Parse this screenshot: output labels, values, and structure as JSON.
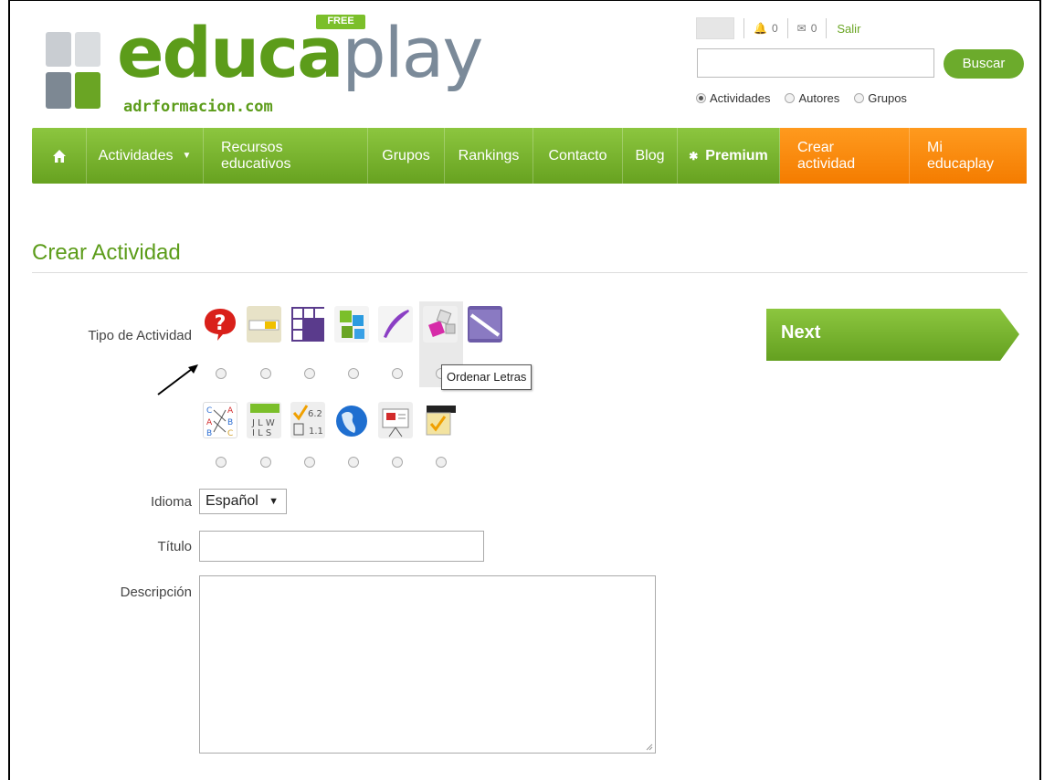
{
  "brand": {
    "logo_main_a": "educa",
    "logo_main_b": "play",
    "logo_sub_a": "adr",
    "logo_sub_b": "formacion.com",
    "free_badge": "FREE",
    "colors": {
      "green": "#6cab2c",
      "orange": "#f47c00",
      "gray": "#7b8a99"
    }
  },
  "topbar": {
    "notifications_count": "0",
    "messages_count": "0",
    "logout_label": "Salir",
    "search_button": "Buscar",
    "search_value": "",
    "search_scope": [
      {
        "label": "Actividades",
        "selected": true
      },
      {
        "label": "Autores",
        "selected": false
      },
      {
        "label": "Grupos",
        "selected": false
      }
    ]
  },
  "nav": {
    "items": [
      {
        "label": "Actividades",
        "icon": "caret-down"
      },
      {
        "label": "Recursos educativos"
      },
      {
        "label": "Grupos"
      },
      {
        "label": "Rankings"
      },
      {
        "label": "Contacto"
      },
      {
        "label": "Blog"
      },
      {
        "label": "Premium",
        "icon": "star"
      },
      {
        "label": "Crear actividad"
      },
      {
        "label": "Mi educaplay"
      }
    ]
  },
  "form": {
    "page_title": "Crear Actividad",
    "tipo_label": "Tipo de Actividad",
    "activity_icons_row1": [
      "quiz-icon",
      "fill-blank-icon",
      "crossword-icon",
      "puzzle-icon",
      "feather-icon",
      "ordenar-letras-icon",
      "word-search-icon"
    ],
    "activity_icons_row2": [
      "relate-icon",
      "letter-soup-icon",
      "test-icon",
      "map-icon",
      "presentation-icon",
      "video-quiz-icon"
    ],
    "tooltip": "Ordenar Letras",
    "next_label": "Next",
    "idioma_label": "Idioma",
    "idioma_value": "Español",
    "titulo_label": "Título",
    "titulo_value": "",
    "descripcion_label": "Descripción",
    "descripcion_value": ""
  }
}
